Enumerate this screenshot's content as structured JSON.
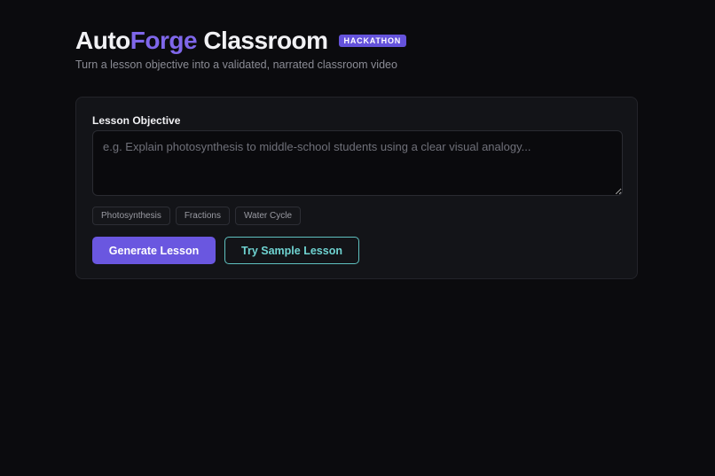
{
  "header": {
    "title_part1": "Auto",
    "title_accent": "Forge",
    "title_part2": " Classroom",
    "badge": "HACKATHON",
    "subtitle": "Turn a lesson objective into a validated, narrated classroom video"
  },
  "form": {
    "label": "Lesson Objective",
    "value": "",
    "placeholder": "e.g. Explain photosynthesis to middle-school students using a clear visual analogy..."
  },
  "chips": [
    {
      "label": "Photosynthesis"
    },
    {
      "label": "Fractions"
    },
    {
      "label": "Water Cycle"
    }
  ],
  "actions": {
    "generate_label": "Generate Lesson",
    "sample_label": "Try Sample Lesson"
  },
  "colors": {
    "background": "#0b0b0e",
    "accent": "#7f67ea",
    "primary_button": "#6a57e0",
    "secondary_button": "#6fd3d1"
  }
}
